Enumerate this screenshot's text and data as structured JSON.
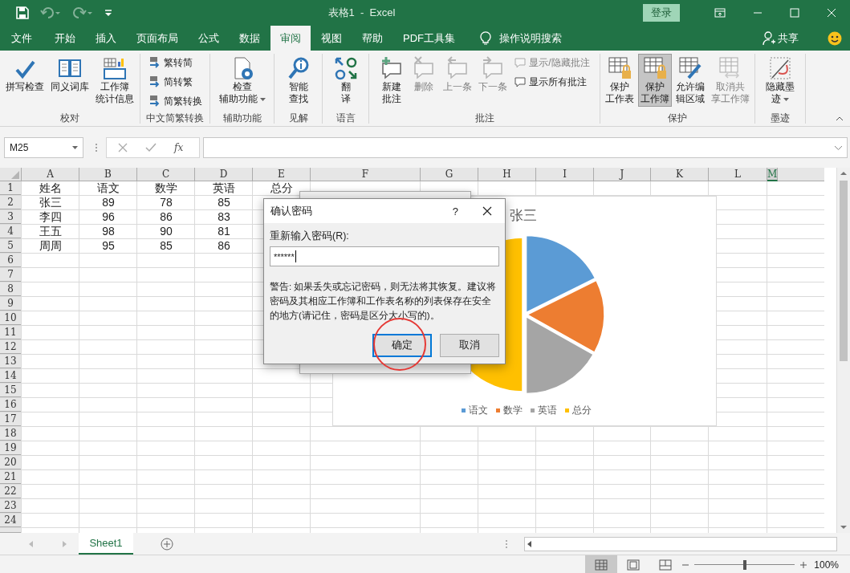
{
  "title_bar": {
    "quick_access": [
      {
        "kind": "save",
        "disabled": false
      },
      {
        "kind": "undo",
        "disabled": true
      },
      {
        "kind": "redo",
        "disabled": true
      },
      {
        "kind": "customize",
        "disabled": false
      }
    ],
    "title": "表格1  -  Excel",
    "login": "登录"
  },
  "tabs": [
    {
      "label": "文件",
      "selected": false
    },
    {
      "label": "开始",
      "selected": false
    },
    {
      "label": "插入",
      "selected": false
    },
    {
      "label": "页面布局",
      "selected": false
    },
    {
      "label": "公式",
      "selected": false
    },
    {
      "label": "数据",
      "selected": false
    },
    {
      "label": "审阅",
      "selected": true
    },
    {
      "label": "视图",
      "selected": false
    },
    {
      "label": "帮助",
      "selected": false
    },
    {
      "label": "PDF工具集",
      "selected": false
    }
  ],
  "tell_me": "操作说明搜索",
  "share": "共享",
  "ribbon": {
    "groups": [
      {
        "label": "校对",
        "items": [
          {
            "kind": "large",
            "label": "拼写检查",
            "disabled": false,
            "pressed": false
          },
          {
            "kind": "large",
            "label": "同义词库",
            "disabled": false,
            "pressed": false
          },
          {
            "kind": "large",
            "label": "工作簿统计信息",
            "disabled": false,
            "pressed": false
          }
        ]
      },
      {
        "label": "中文简繁转换",
        "items": [
          {
            "kind": "small",
            "label": "繁转简",
            "disabled": false,
            "pressed": false
          },
          {
            "kind": "small",
            "label": "简转繁",
            "disabled": false,
            "pressed": false
          },
          {
            "kind": "small",
            "label": "简繁转换",
            "disabled": false,
            "pressed": false
          }
        ]
      },
      {
        "label": "辅助功能",
        "items": [
          {
            "kind": "large",
            "label": "检查辅助功能",
            "disabled": false,
            "pressed": false,
            "dropdown": true
          }
        ]
      },
      {
        "label": "见解",
        "items": [
          {
            "kind": "large",
            "label": "智能查找",
            "disabled": false,
            "pressed": false
          }
        ]
      },
      {
        "label": "语言",
        "items": [
          {
            "kind": "large",
            "label": "翻译",
            "disabled": false,
            "pressed": false
          }
        ]
      },
      {
        "label": "批注",
        "items": [
          {
            "kind": "large",
            "label": "新建批注",
            "disabled": false,
            "pressed": false
          },
          {
            "kind": "large",
            "label": "删除",
            "disabled": true,
            "pressed": false
          },
          {
            "kind": "large",
            "label": "上一条",
            "disabled": true,
            "pressed": false
          },
          {
            "kind": "large",
            "label": "下一条",
            "disabled": true,
            "pressed": false
          },
          {
            "kind": "small",
            "label": "显示/隐藏批注",
            "disabled": true,
            "pressed": false
          },
          {
            "kind": "small",
            "label": "显示所有批注",
            "disabled": false,
            "pressed": false
          }
        ]
      },
      {
        "label": "保护",
        "items": [
          {
            "kind": "large",
            "label": "保护工作表",
            "disabled": false,
            "pressed": false
          },
          {
            "kind": "large",
            "label": "保护工作簿",
            "disabled": false,
            "pressed": true
          },
          {
            "kind": "large",
            "label": "允许编辑区域",
            "disabled": false,
            "pressed": false
          },
          {
            "kind": "large",
            "label": "取消共享工作簿",
            "disabled": true,
            "pressed": false
          }
        ]
      },
      {
        "label": "墨迹",
        "items": [
          {
            "kind": "large",
            "label": "隐藏墨迹",
            "disabled": false,
            "pressed": false,
            "dropdown": true
          }
        ]
      }
    ]
  },
  "formula_bar": {
    "name_box": "M25",
    "function_label": "fx"
  },
  "sheet": {
    "columns": [
      {
        "label": "A",
        "selected": false
      },
      {
        "label": "B",
        "selected": false
      },
      {
        "label": "C",
        "selected": false
      },
      {
        "label": "D",
        "selected": false
      },
      {
        "label": "E",
        "selected": false
      },
      {
        "label": "F",
        "selected": false
      },
      {
        "label": "G",
        "selected": false
      },
      {
        "label": "H",
        "selected": false
      },
      {
        "label": "I",
        "selected": false
      },
      {
        "label": "J",
        "selected": false
      },
      {
        "label": "K",
        "selected": false
      },
      {
        "label": "L",
        "selected": false
      },
      {
        "label": "M",
        "selected": true
      }
    ],
    "rows": [
      {
        "label": "1",
        "cells": [
          "姓名",
          "语文",
          "数学",
          "英语",
          "总分"
        ]
      },
      {
        "label": "2",
        "cells": [
          "张三",
          "89",
          "78",
          "85"
        ]
      },
      {
        "label": "3",
        "cells": [
          "李四",
          "96",
          "86",
          "83"
        ]
      },
      {
        "label": "4",
        "cells": [
          "王五",
          "98",
          "90",
          "81"
        ]
      },
      {
        "label": "5",
        "cells": [
          "周周",
          "95",
          "85",
          "86"
        ]
      },
      {
        "label": "6",
        "cells": []
      },
      {
        "label": "7",
        "cells": []
      },
      {
        "label": "8",
        "cells": []
      },
      {
        "label": "9",
        "cells": []
      },
      {
        "label": "10",
        "cells": []
      },
      {
        "label": "11",
        "cells": []
      },
      {
        "label": "12",
        "cells": []
      },
      {
        "label": "13",
        "cells": []
      },
      {
        "label": "14",
        "cells": []
      },
      {
        "label": "15",
        "cells": []
      },
      {
        "label": "16",
        "cells": []
      },
      {
        "label": "17",
        "cells": []
      },
      {
        "label": "18",
        "cells": []
      },
      {
        "label": "19",
        "cells": []
      },
      {
        "label": "20",
        "cells": []
      },
      {
        "label": "21",
        "cells": []
      },
      {
        "label": "22",
        "cells": []
      },
      {
        "label": "23",
        "cells": []
      },
      {
        "label": "24",
        "cells": []
      }
    ]
  },
  "chart": {
    "title": "张三",
    "legend": [
      {
        "label": "语文",
        "color": "#5b9bd5"
      },
      {
        "label": "数学",
        "color": "#ed7d31"
      },
      {
        "label": "英语",
        "color": "#a5a5a5"
      },
      {
        "label": "总分",
        "color": "#ffc000"
      }
    ]
  },
  "dialog": {
    "title": "确认密码",
    "help": "?",
    "field_label": "重新输入密码(R):",
    "value": "******",
    "warning": "警告: 如果丢失或忘记密码，则无法将其恢复。建议将密码及其相应工作簿和工作表名称的列表保存在安全的地方(请记住，密码是区分大小写的)。",
    "buttons": [
      {
        "label": "确定",
        "focused": true
      },
      {
        "label": "取消",
        "focused": false
      }
    ]
  },
  "sheet_tabs": [
    {
      "label": "Sheet1",
      "selected": true
    }
  ],
  "status_bar": {
    "views": [
      {
        "kind": "normal",
        "selected": true
      },
      {
        "kind": "page_layout",
        "selected": false
      },
      {
        "kind": "page_break",
        "selected": false
      }
    ],
    "zoom": {
      "level": 0.5,
      "reading": "100%"
    }
  }
}
